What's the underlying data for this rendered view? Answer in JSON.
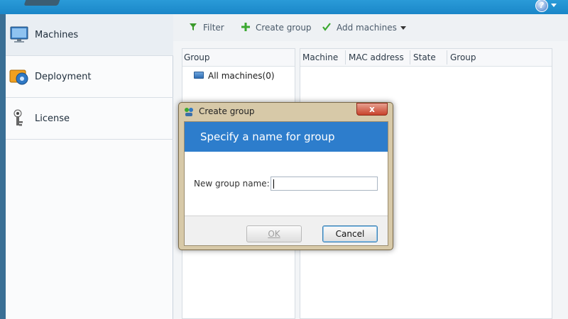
{
  "window": {
    "accent_color": "#1a86c8"
  },
  "header": {
    "help_icon": "help-icon",
    "help_glyph": "?"
  },
  "sidebar": {
    "items": [
      {
        "label": "Machines",
        "icon": "monitor-icon",
        "selected": true
      },
      {
        "label": "Deployment",
        "icon": "deployment-icon",
        "selected": false
      },
      {
        "label": "License",
        "icon": "license-icon",
        "selected": false
      }
    ]
  },
  "toolbar": {
    "filter_label": "Filter",
    "create_group_label": "Create group",
    "add_machines_label": "Add machines"
  },
  "group_panel": {
    "header": "Group",
    "items": [
      {
        "label": "All machines(0)"
      }
    ]
  },
  "machine_panel": {
    "columns": [
      "Machine",
      "MAC address",
      "State",
      "Group"
    ]
  },
  "dialog": {
    "title": "Create group",
    "close_glyph": "x",
    "heading": "Specify a name for group",
    "field_label": "New group name:",
    "field_value": "",
    "ok_label": "OK",
    "cancel_label": "Cancel",
    "banner_color": "#2d7dcc"
  }
}
